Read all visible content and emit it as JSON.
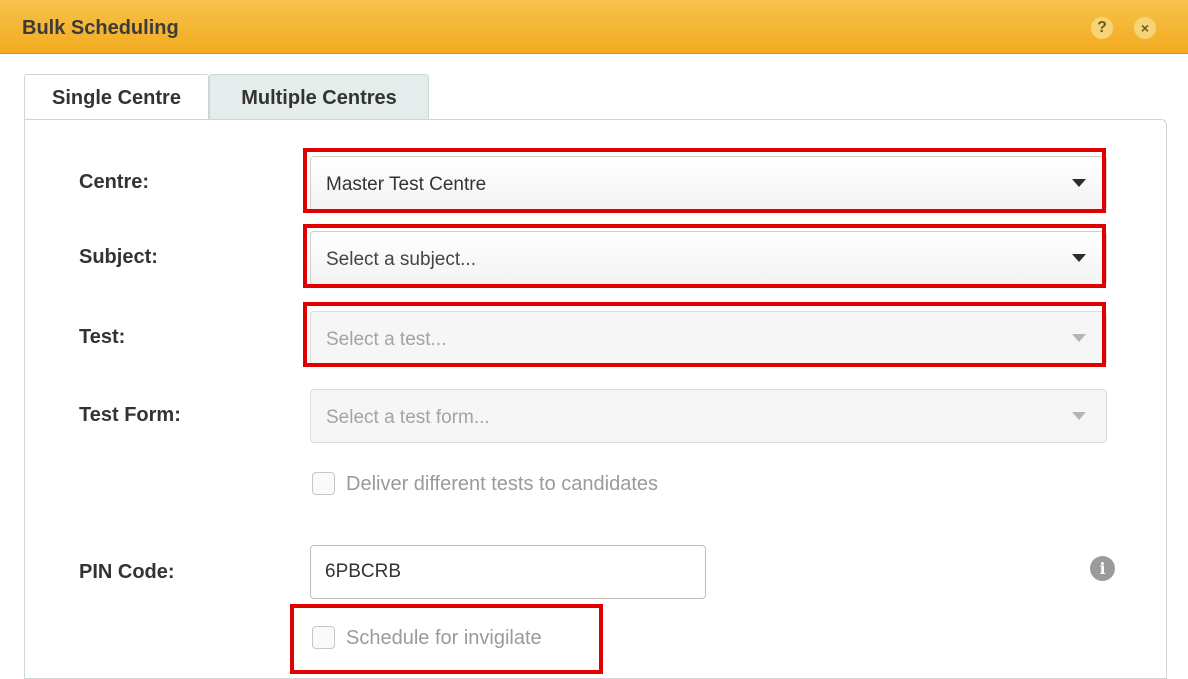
{
  "window": {
    "title": "Bulk Scheduling",
    "help_glyph": "?",
    "close_glyph": "×"
  },
  "tabs": [
    {
      "label": "Single Centre",
      "active": true
    },
    {
      "label": "Multiple Centres",
      "active": false
    }
  ],
  "form": {
    "centre": {
      "label": "Centre:",
      "value": "Master Test Centre"
    },
    "subject": {
      "label": "Subject:",
      "placeholder": "Select a subject..."
    },
    "test": {
      "label": "Test:",
      "placeholder": "Select a test...",
      "disabled": true
    },
    "test_form": {
      "label": "Test Form:",
      "placeholder": "Select a test form...",
      "disabled": true
    },
    "deliver_different": {
      "label": "Deliver different tests to candidates",
      "checked": false,
      "disabled": true
    },
    "pin_code": {
      "label": "PIN Code:",
      "value": "6PBCRB"
    },
    "schedule_invigilate": {
      "label": "Schedule for invigilate",
      "checked": false,
      "disabled": true
    }
  },
  "icons": {
    "info": "i",
    "caret": "caret-down-icon"
  },
  "colors": {
    "titlebar": "#f2ab1f",
    "highlight": "#e00000",
    "tab_inactive": "#e5ecec"
  }
}
